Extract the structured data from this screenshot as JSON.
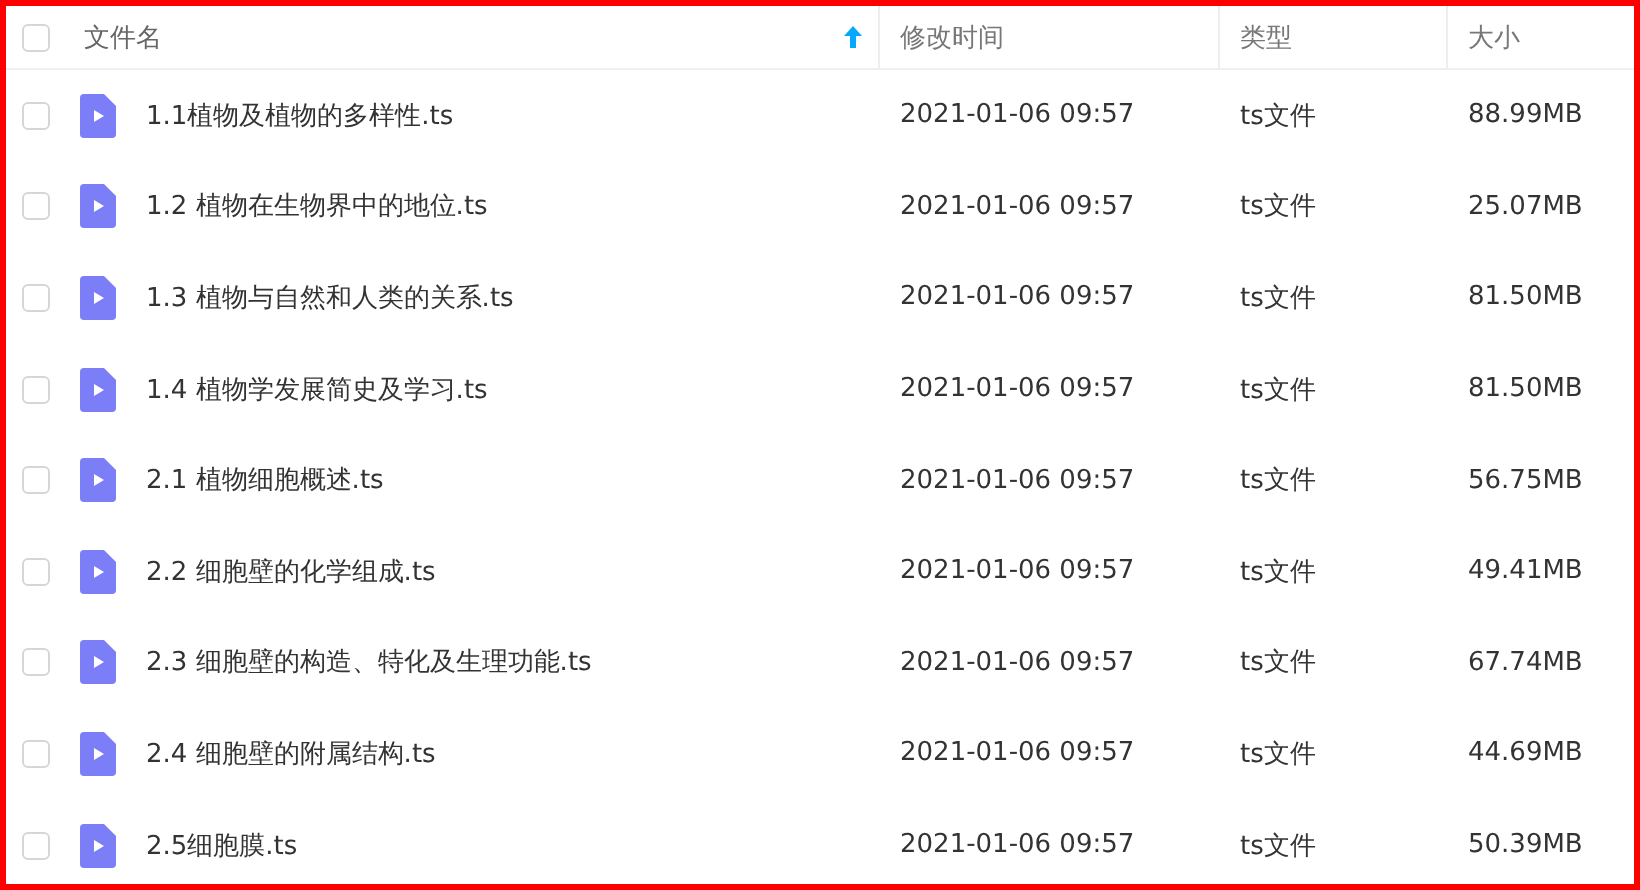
{
  "header": {
    "checked": false,
    "columns": [
      {
        "label": "文件名",
        "sorted": true
      },
      {
        "label": "修改时间",
        "sorted": false
      },
      {
        "label": "类型",
        "sorted": false
      },
      {
        "label": "大小",
        "sorted": false
      }
    ]
  },
  "rows": [
    {
      "checked": false,
      "name": "1.1植物及植物的多样性.ts",
      "modified": "2021-01-06 09:57",
      "type": "ts文件",
      "size": "88.99MB"
    },
    {
      "checked": false,
      "name": "1.2 植物在生物界中的地位.ts",
      "modified": "2021-01-06 09:57",
      "type": "ts文件",
      "size": "25.07MB"
    },
    {
      "checked": false,
      "name": "1.3 植物与自然和人类的关系.ts",
      "modified": "2021-01-06 09:57",
      "type": "ts文件",
      "size": "81.50MB"
    },
    {
      "checked": false,
      "name": "1.4 植物学发展简史及学习.ts",
      "modified": "2021-01-06 09:57",
      "type": "ts文件",
      "size": "81.50MB"
    },
    {
      "checked": false,
      "name": "2.1 植物细胞概述.ts",
      "modified": "2021-01-06 09:57",
      "type": "ts文件",
      "size": "56.75MB"
    },
    {
      "checked": false,
      "name": "2.2 细胞壁的化学组成.ts",
      "modified": "2021-01-06 09:57",
      "type": "ts文件",
      "size": "49.41MB"
    },
    {
      "checked": false,
      "name": "2.3 细胞壁的构造、特化及生理功能.ts",
      "modified": "2021-01-06 09:57",
      "type": "ts文件",
      "size": "67.74MB"
    },
    {
      "checked": false,
      "name": "2.4 细胞壁的附属结构.ts",
      "modified": "2021-01-06 09:57",
      "type": "ts文件",
      "size": "44.69MB"
    },
    {
      "checked": false,
      "name": "2.5细胞膜.ts",
      "modified": "2021-01-06 09:57",
      "type": "ts文件",
      "size": "50.39MB"
    }
  ]
}
